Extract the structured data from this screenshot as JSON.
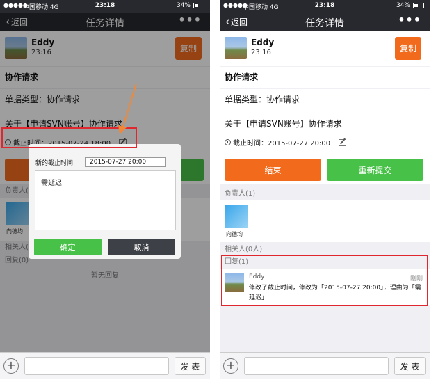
{
  "status": {
    "signal": "●●●●●",
    "carrier": "中国移动",
    "network": "4G",
    "time": "23:18",
    "battery": "34%",
    "battery_level": 0.34
  },
  "nav": {
    "back_label": "返回",
    "title": "任务详情",
    "more_label": "•••"
  },
  "task": {
    "author": "Eddy",
    "author_time": "23:16",
    "copy_label": "复制",
    "heading": "协作请求",
    "type_text": "单据类型：协作请求",
    "subject_text": "关于【申请SVN账号】协作请求"
  },
  "left": {
    "deadline_text": "截止时间：2015-07-24 18:00",
    "owner_label": "负责人(",
    "owner_name": "向德均",
    "related_label": "相关人(",
    "reply_label": "回复(0)",
    "empty_reply": "暂无回复",
    "dialog": {
      "label": "新的截止时间:",
      "date_value": "2015-07-27 20:00",
      "reason_text": "需延迟",
      "ok_label": "确定",
      "cancel_label": "取消"
    }
  },
  "right": {
    "deadline_text": "截止时间：2015-07-27 20:00",
    "end_label": "结束",
    "resubmit_label": "重新提交",
    "owner_label": "负责人(1)",
    "owner_name": "向德均",
    "related_label": "相关人(0人)",
    "reply_label": "回复(1)",
    "reply": {
      "name": "Eddy",
      "when": "刚刚",
      "text": "修改了截止时间，修改为「2015-07-27 20:00」，理由为「需延迟」"
    }
  },
  "bottom": {
    "plus_label": "+",
    "send_label": "发 表"
  },
  "colors": {
    "orange": "#f26b1d",
    "green": "#47c147",
    "dark": "#28292e",
    "highlight": "#e0262e"
  }
}
